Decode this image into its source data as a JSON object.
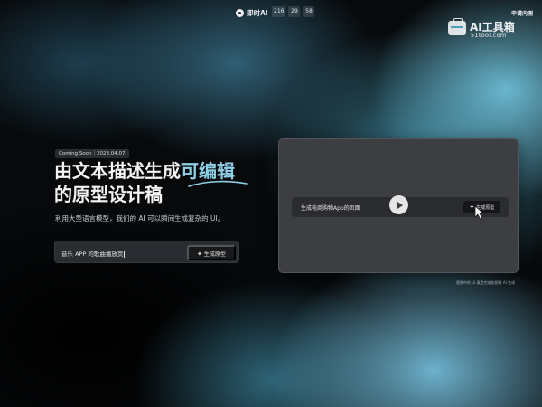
{
  "topbar": {
    "brand": "即时AI",
    "countdown": [
      "216",
      "29",
      "58"
    ],
    "login": "申请内测"
  },
  "watermark": {
    "title": "AI工具箱",
    "sub": "51tool.com"
  },
  "hero": {
    "badge": "Coming Soon｜2023.04.07",
    "headline_line1_plain": "由文本描述生成",
    "headline_line1_highlight": "可编辑",
    "headline_line2": "的原型设计稿",
    "subtitle": "利用大型语言模型，我们的 AI 可以瞬间生成复杂的 UI。",
    "prompt_value": "音乐 APP 的歌曲播放页",
    "generate_label": "生成原型"
  },
  "preview": {
    "prompt_text": "生成电商购物App的页面",
    "generate_label": "生成原型",
    "caption": "视频中的 UI 真是完成由即时 AI 生成"
  },
  "colors": {
    "accent": "#8fd0e6",
    "background": "#07090b",
    "card": "#3d3e41"
  },
  "icons": {
    "brand": "logo-icon",
    "generate": "sparkle-icon",
    "play": "play-icon",
    "cursor": "mouse-pointer-icon"
  }
}
